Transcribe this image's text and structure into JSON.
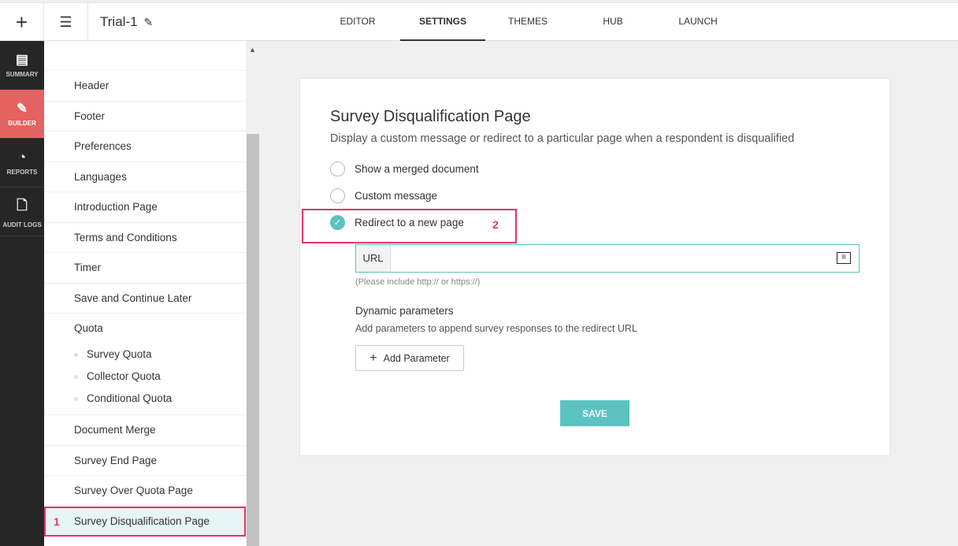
{
  "header": {
    "title": "Trial-1",
    "tabs": [
      "EDITOR",
      "SETTINGS",
      "THEMES",
      "HUB",
      "LAUNCH"
    ]
  },
  "rail": [
    "SUMMARY",
    "BUILDER",
    "REPORTS",
    "AUDIT LOGS"
  ],
  "sidebar": {
    "items": [
      "Header",
      "Footer",
      "Preferences",
      "Languages",
      "Introduction Page",
      "Terms and Conditions",
      "Timer",
      "Save and Continue Later"
    ],
    "quota": "Quota",
    "quota_sub": [
      "Survey Quota",
      "Collector Quota",
      "Conditional Quota"
    ],
    "items2": [
      "Document Merge",
      "Survey End Page",
      "Survey Over Quota Page"
    ],
    "selected": "Survey Disqualification Page",
    "badge": "1"
  },
  "main": {
    "title": "Survey Disqualification Page",
    "description": "Display a custom message or redirect to a particular page when a respondent is disqualified",
    "options": [
      "Show a merged document",
      "Custom message",
      "Redirect to a new page"
    ],
    "badge": "2",
    "url_label": "URL",
    "url_value": "",
    "hint": "(Please include http:// or https://)",
    "dyn_title": "Dynamic parameters",
    "dyn_desc": "Add parameters to append survey responses to the redirect URL",
    "add_param": "Add Parameter",
    "save": "SAVE"
  },
  "colors": {
    "accent": "#5cc2c2",
    "builder": "#e46262",
    "highlight": "#e8336a"
  }
}
